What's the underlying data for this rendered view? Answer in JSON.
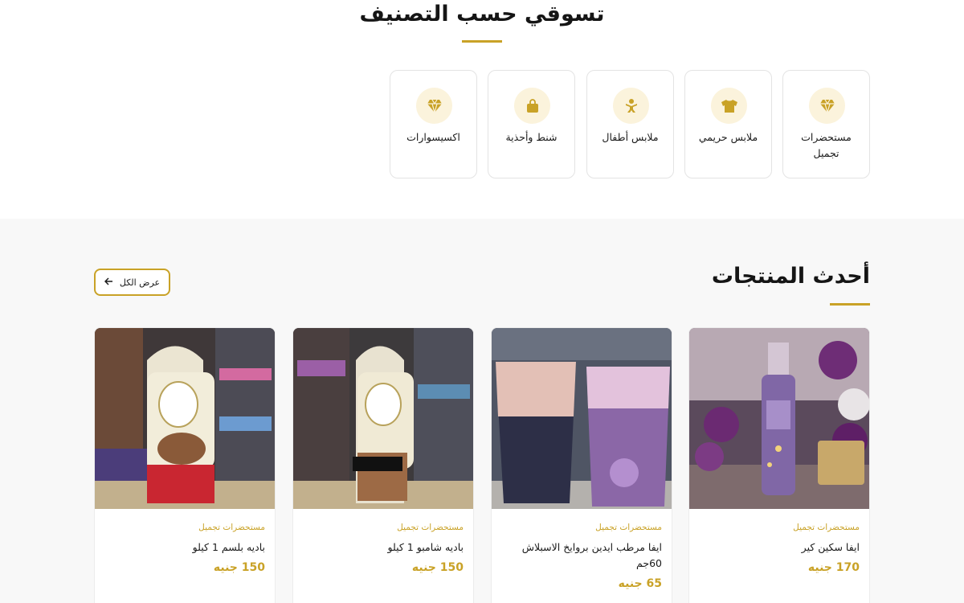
{
  "categories": {
    "title": "تسوقي حسب التصنيف",
    "items": [
      {
        "label": "مستحضرات تجميل",
        "icon": "diamond-icon"
      },
      {
        "label": "ملابس حريمي",
        "icon": "tshirt-icon"
      },
      {
        "label": "ملابس أطفال",
        "icon": "child-icon"
      },
      {
        "label": "شنط وأحذية",
        "icon": "bag-icon"
      },
      {
        "label": "اكسيسوارات",
        "icon": "diamond-icon"
      }
    ]
  },
  "latest": {
    "title": "أحدث المنتجات",
    "view_all_label": "عرض الكل",
    "products": [
      {
        "category": "مستحضرات تجميل",
        "name": "ايفا سكين كير",
        "price": "170 جنيه",
        "image": "perfume-mist-photo"
      },
      {
        "category": "مستحضرات تجميل",
        "name": "ايفا مرطب ايدين بروايخ الاسبلاش 60جم",
        "price": "65 جنيه",
        "image": "hand-cream-photo"
      },
      {
        "category": "مستحضرات تجميل",
        "name": "باديه شامبو 1 كيلو",
        "price": "150 جنيه",
        "image": "shampoo-bottle-photo"
      },
      {
        "category": "مستحضرات تجميل",
        "name": "باديه بلسم 1 كيلو",
        "price": "150 جنيه",
        "image": "conditioner-bottle-photo"
      }
    ]
  },
  "colors": {
    "accent": "#c9a227",
    "icon_bg": "#fbf3dc",
    "section_bg": "#f8f8f8"
  }
}
